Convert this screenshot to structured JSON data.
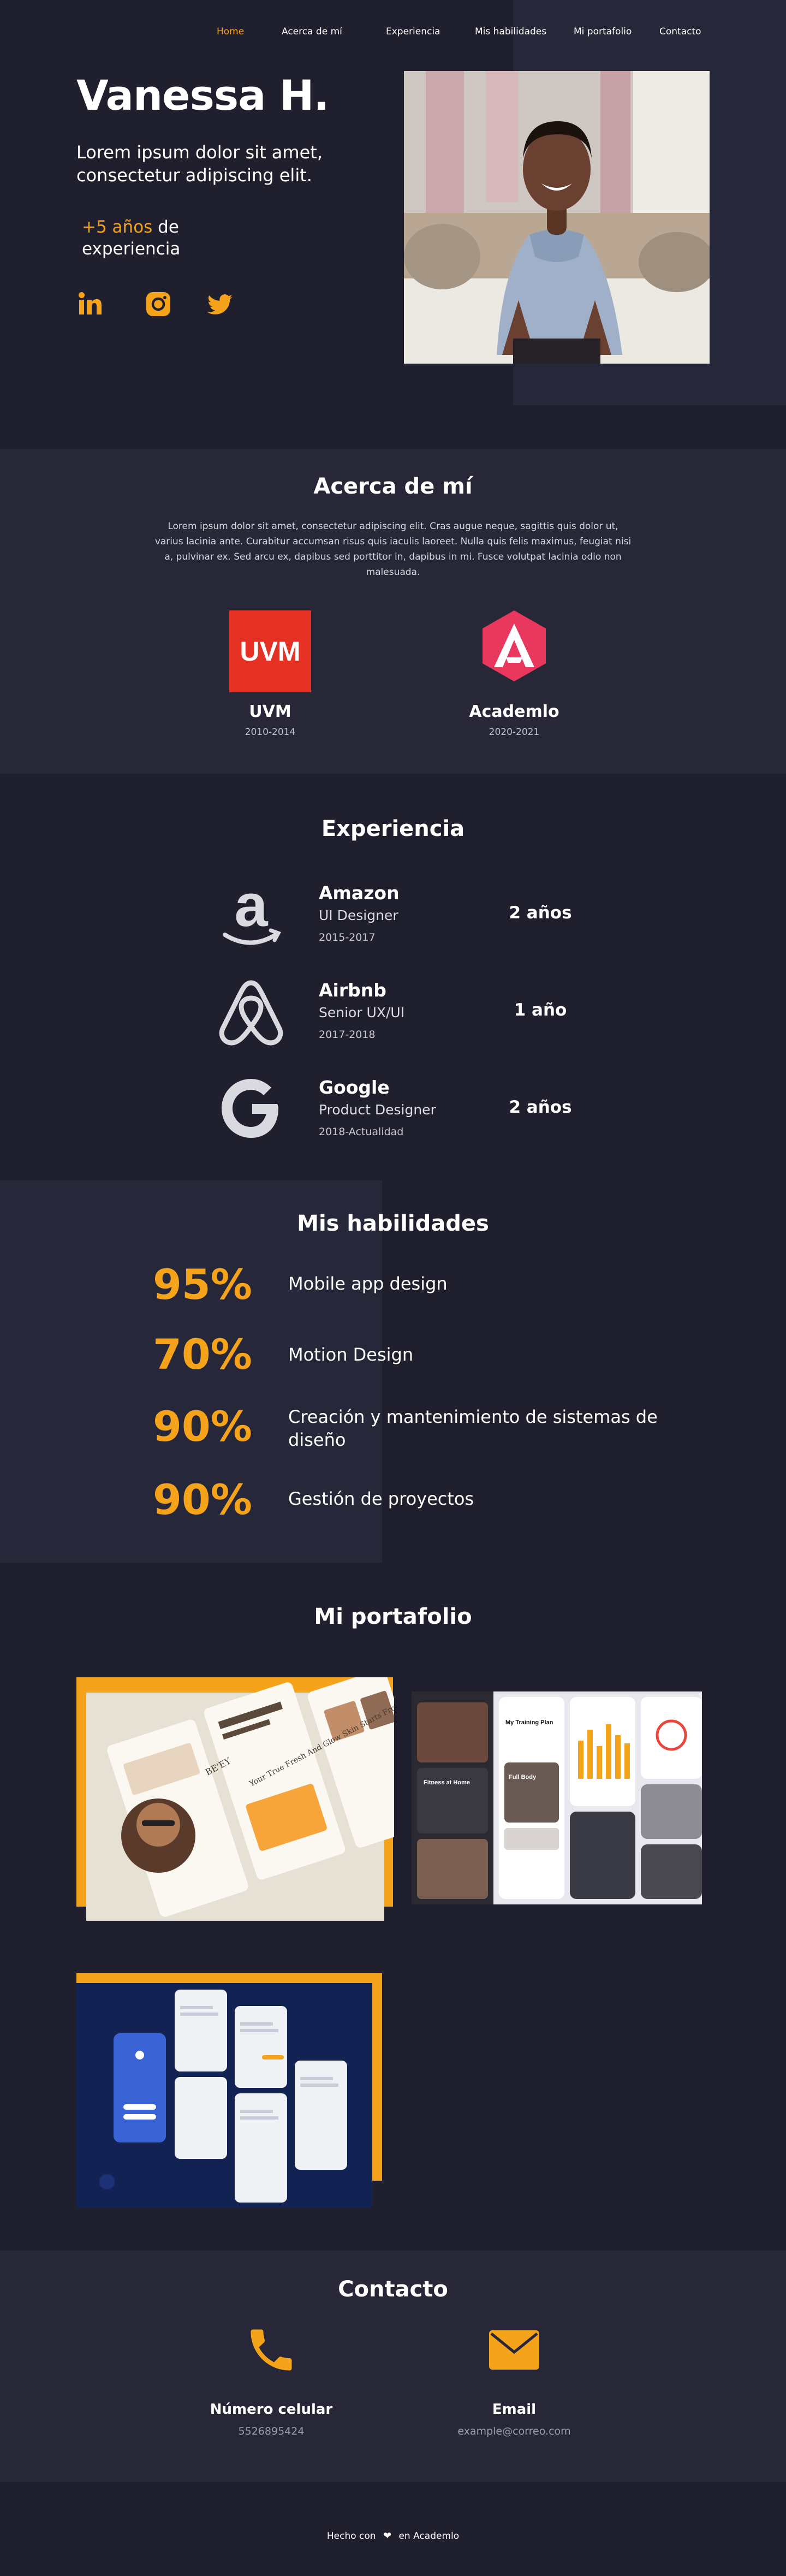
{
  "nav": {
    "items": [
      {
        "label": "Home"
      },
      {
        "label": "Acerca de mí"
      },
      {
        "label": "Experiencia"
      },
      {
        "label": "Mis habilidades"
      },
      {
        "label": "Mi portafolio"
      },
      {
        "label": "Contacto"
      }
    ],
    "active_color": "#f5a31a"
  },
  "hero": {
    "name": "Vanessa H.",
    "lead": "Lorem ipsum dolor sit amet, consectetur adipiscing elit.",
    "exp_accent": "+5 años",
    "exp_rest_1": " de",
    "exp_rest_2": "experiencia",
    "socials": [
      {
        "icon": "linkedin-icon"
      },
      {
        "icon": "instagram-icon"
      },
      {
        "icon": "twitter-icon"
      }
    ]
  },
  "about": {
    "title": "Acerca de mí",
    "text": "Lorem ipsum dolor sit amet, consectetur adipiscing elit. Cras augue neque, sagittis quis dolor ut, varius lacinia ante. Curabitur accumsan risus quis iaculis laoreet. Nulla quis felis maximus, feugiat nisi a, pulvinar ex. Sed arcu ex, dapibus sed porttitor in, dapibus in mi. Fusce volutpat lacinia odio non malesuada.",
    "education": [
      {
        "name": "UVM",
        "logo_text": "UVM",
        "years": "2010-2014"
      },
      {
        "name": "Academlo",
        "years": "2020-2021"
      }
    ]
  },
  "experience": {
    "title": "Experiencia",
    "jobs": [
      {
        "company": "Amazon",
        "role": "UI Designer",
        "dates": "2015-2017",
        "duration": "2 años",
        "icon": "amazon-icon"
      },
      {
        "company": "Airbnb",
        "role": "Senior UX/UI",
        "dates": "2017-2018",
        "duration": "1 año",
        "icon": "airbnb-icon"
      },
      {
        "company": "Google",
        "role": "Product Designer",
        "dates": "2018-Actualidad",
        "duration": "2 años",
        "icon": "google-icon"
      }
    ]
  },
  "skills": {
    "title": "Mis habilidades",
    "items": [
      {
        "percent": "95%",
        "label": "Mobile app design"
      },
      {
        "percent": "70%",
        "label": "Motion Design"
      },
      {
        "percent": "90%",
        "label": "Creación y mantenimiento de sistemas de diseño"
      },
      {
        "percent": "90%",
        "label": "Gestión de proyectos"
      }
    ]
  },
  "portfolio": {
    "title": "Mi portafolio",
    "accent_color": "#f5a31a",
    "mock_texts": {
      "fitness_title": "My Training Plan",
      "fitness_banner": "Fitness at Home",
      "fitness_full": "Full Body",
      "beauty_brand": "BE'EY",
      "beauty_tagline": "Your True Fresh And Glow Skin Starts From Here"
    }
  },
  "contact": {
    "title": "Contacto",
    "items": [
      {
        "title": "Número celular",
        "value": "5526895424",
        "icon": "phone-icon"
      },
      {
        "title": "Email",
        "value": "example@correo.com",
        "icon": "mail-icon"
      }
    ]
  },
  "footer": {
    "made_with": "Hecho con",
    "heart_icon": "heart-icon",
    "at": "en Academlo"
  }
}
